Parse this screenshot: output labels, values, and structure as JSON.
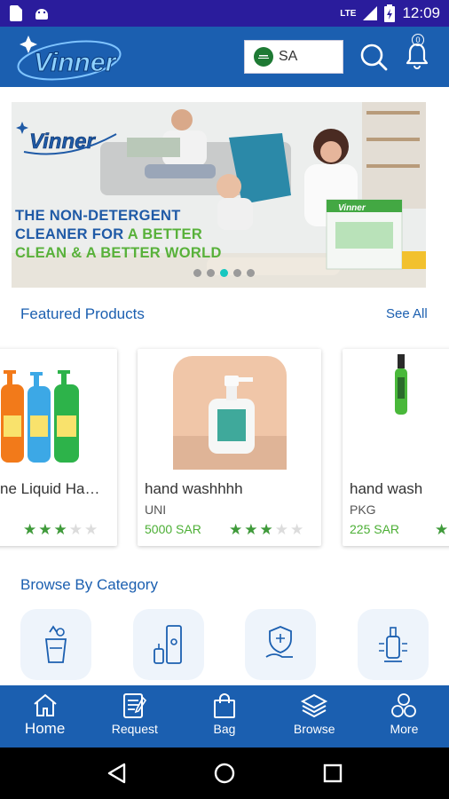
{
  "status_bar": {
    "network": "LTE",
    "time": "12:09"
  },
  "header": {
    "logo_text": "Vinner",
    "country_code": "SA",
    "notification_count": "0"
  },
  "banner": {
    "logo_text": "Vinner",
    "line1": "THE NON-DETERGENT",
    "line2_a": "CLEANER FOR ",
    "line2_b": "A BETTER",
    "line3": "CLEAN & A BETTER WORLD",
    "box_brand": "Vinner",
    "active_dot": 3,
    "dot_count": 5
  },
  "featured": {
    "title": "Featured Products",
    "see_all": "See All",
    "products": [
      {
        "name": "ne Liquid Ha…",
        "brand": "",
        "price": "",
        "rating": 3
      },
      {
        "name": "hand washhhh",
        "brand": "UNI",
        "price": "5000 SAR",
        "rating": 3
      },
      {
        "name": "hand wash",
        "brand": "PKG",
        "price": "225 SAR",
        "rating": 1
      }
    ]
  },
  "categories": {
    "title": "Browse By Category",
    "icons": [
      "cleaning-cup-icon",
      "door-spray-icon",
      "hand-shield-icon",
      "bottle-device-icon"
    ]
  },
  "bottom_nav": {
    "items": [
      {
        "label": "Home",
        "icon": "home-icon"
      },
      {
        "label": "Request",
        "icon": "request-icon"
      },
      {
        "label": "Bag",
        "icon": "bag-icon"
      },
      {
        "label": "Browse",
        "icon": "browse-icon"
      },
      {
        "label": "More",
        "icon": "more-icon"
      }
    ]
  },
  "colors": {
    "status_bar": "#2a1c9c",
    "primary": "#1b5fb0",
    "price_green": "#4caf35",
    "star_green": "#3f9a3a"
  }
}
